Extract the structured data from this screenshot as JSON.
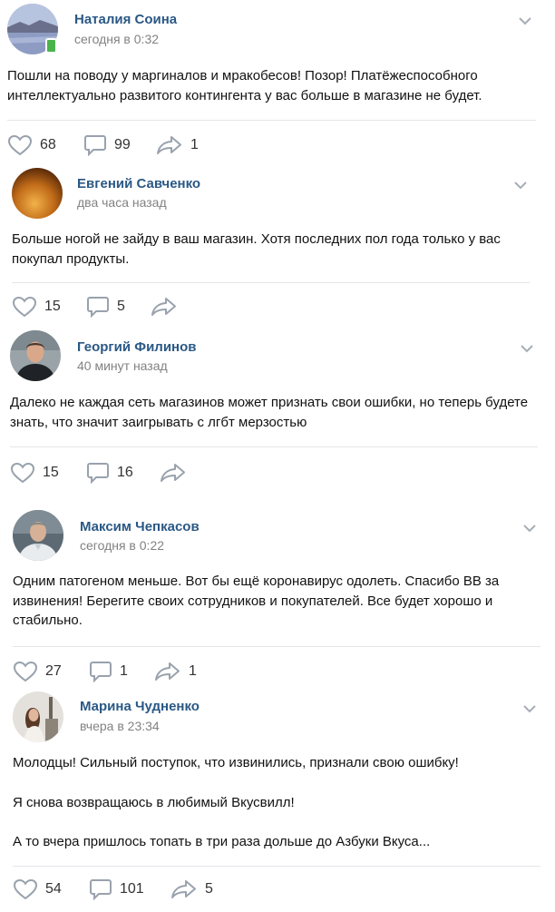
{
  "posts": [
    {
      "author": "Наталия Соина",
      "time": "сегодня в 0:32",
      "text": [
        "Пошли на поводу у маргиналов и мракобесов! Позор! Платёжеспособного интеллектуально развитого контингента у вас больше в магазине не будет."
      ],
      "likes": "68",
      "comments": "99",
      "shares": "1",
      "avatar_icon": "lake-landscape-avatar",
      "online_mobile": true
    },
    {
      "author": "Евгений Савченко",
      "time": "два часа назад",
      "text": [
        "Больше ногой не зайду в ваш магазин. Хотя последних пол года только у вас покупал продукты."
      ],
      "likes": "15",
      "comments": "5",
      "shares": "",
      "avatar_icon": "orange-glow-avatar"
    },
    {
      "author": "Георгий Филинов",
      "time": "40 минут назад",
      "text": [
        "Далеко не каждая сеть магазинов может признать свои ошибки, но теперь будете знать, что значит заигрывать с лгбт мерзостью"
      ],
      "likes": "15",
      "comments": "16",
      "shares": "",
      "avatar_icon": "man-dark-shirt-avatar"
    },
    {
      "author": "Максим Чепкасов",
      "time": "сегодня в 0:22",
      "text": [
        "Одним патогеном меньше. Вот бы ещё коронавирус одолеть. Спасибо ВВ за извинения! Берегите своих сотрудников и покупателей. Все будет хорошо и стабильно."
      ],
      "likes": "27",
      "comments": "1",
      "shares": "1",
      "avatar_icon": "man-white-shirt-avatar"
    },
    {
      "author": "Марина Чудненко",
      "time": "вчера в 23:34",
      "text": [
        "Молодцы! Сильный поступок, что извинились, признали свою ошибку!",
        "Я снова возвращаюсь в любимый Вкусвилл!",
        "А то вчера пришлось топать в три раза дольше до Азбуки Вкуса..."
      ],
      "likes": "54",
      "comments": "101",
      "shares": "5",
      "avatar_icon": "woman-city-avatar"
    }
  ],
  "colors": {
    "name": "#2a5885",
    "time": "#828282",
    "icon": "#99a2ad",
    "online": "#4bb34b"
  }
}
